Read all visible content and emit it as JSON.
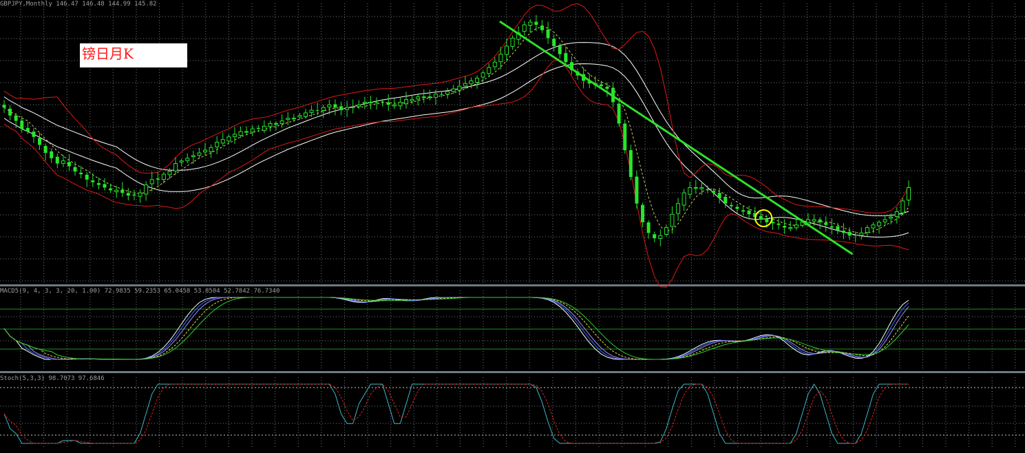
{
  "header": {
    "main": "GBPJPY,Monthly  146.47 146.48 144.99 145.82",
    "panel1": "MACD5(9, 4, 3, 3, 20, 1.00) 72.9835 59.2353 65.0458 53.8504 52.7842 76.7340",
    "panel2": "Stoch(5,3,3) 98.7073 97.6846"
  },
  "label": "镑日月K",
  "colors": {
    "background": "#000000",
    "grid": "#6e7a82",
    "bull": "#27e62b",
    "bear": "#27e62b",
    "band_outer": "#e01818",
    "band_inner": "#ffffff",
    "midline": "#d6d26a",
    "trendline": "#2ee02a",
    "circle": "#ffff00",
    "stoch_main": "#3fb7c4",
    "stoch_signal": "#e02020",
    "osc_lines": [
      "#ffffff",
      "#3f6bff",
      "#a78cff",
      "#e6e23a",
      "#33cc33"
    ]
  },
  "chart_data": [
    {
      "type": "candlestick",
      "title": "",
      "symbol": "GBPJPY",
      "timeframe": "Monthly",
      "last_bar": {
        "open": 146.47,
        "high": 146.48,
        "low": 144.99,
        "close": 145.82
      },
      "ylim": [
        110,
        215
      ],
      "note_label": "镑日月K",
      "close": [
        176,
        173,
        171,
        168,
        167,
        165,
        162,
        159,
        157,
        155,
        156,
        154,
        152,
        151,
        149,
        148,
        147,
        146,
        145,
        145,
        144,
        143,
        143,
        144,
        147,
        149,
        149,
        151,
        152,
        155,
        156,
        157,
        158,
        159,
        160,
        161,
        163,
        164,
        165,
        166,
        167,
        167,
        168,
        168,
        169,
        170,
        170,
        171,
        172,
        172,
        173,
        174,
        175,
        175,
        176,
        177,
        176,
        175,
        176,
        176,
        177,
        178,
        178,
        178,
        178,
        177,
        177,
        178,
        179,
        179,
        180,
        180,
        180,
        181,
        181,
        182,
        183,
        184,
        185,
        186,
        187,
        189,
        191,
        193,
        196,
        199,
        202,
        204,
        207,
        208,
        207,
        205,
        202,
        199,
        196,
        193,
        190,
        188,
        186,
        185,
        185,
        184,
        183,
        178,
        170,
        160,
        150,
        140,
        133,
        129,
        127,
        128,
        131,
        136,
        140,
        144,
        146,
        146,
        146,
        145,
        144,
        142,
        140,
        139,
        138,
        137,
        136,
        135,
        134,
        133,
        133,
        132,
        131,
        131,
        132,
        133,
        134,
        134,
        133,
        132,
        131,
        130,
        129,
        128,
        128,
        129,
        131,
        132,
        133,
        134,
        135,
        137,
        141,
        146
      ],
      "trendline": {
        "from_index": 85,
        "to_index": 147,
        "from_value": 208,
        "to_value": 119
      },
      "marker_circle_index": 128
    },
    {
      "type": "line",
      "title": "MACD5(9, 4, 3, 3, 20, 1.00)",
      "values_header": [
        72.9835,
        59.2353,
        65.0458,
        53.8504,
        52.7842,
        76.734
      ],
      "levels": [
        80,
        50,
        20
      ]
    },
    {
      "type": "line",
      "title": "Stoch(5,3,3)",
      "main_last": 98.7073,
      "signal_last": 97.6846,
      "levels": [
        80,
        20
      ]
    }
  ]
}
